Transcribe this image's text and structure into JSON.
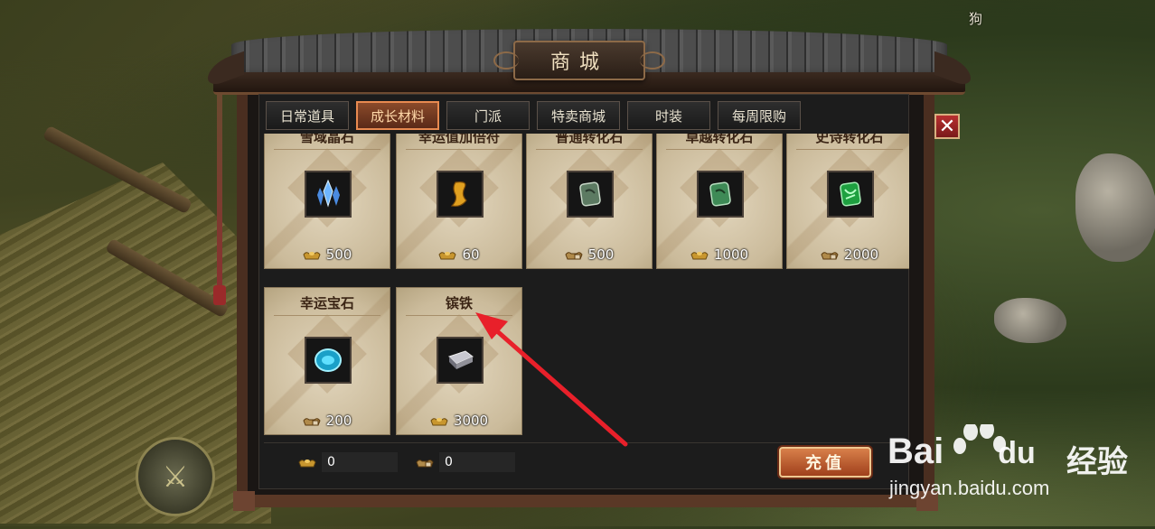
{
  "window": {
    "title": "商城"
  },
  "tabs": [
    {
      "label": "日常道具",
      "active": false
    },
    {
      "label": "成长材料",
      "active": true
    },
    {
      "label": "门派",
      "active": false
    },
    {
      "label": "特卖商城",
      "active": false
    },
    {
      "label": "时装",
      "active": false
    },
    {
      "label": "每周限购",
      "active": false
    }
  ],
  "items": [
    {
      "name": "雪域晶石",
      "price": "500",
      "currency": "gold-ingot",
      "icon": "crystal-icon"
    },
    {
      "name": "幸运值加倍符",
      "price": "60",
      "currency": "gold-ingot",
      "icon": "talisman-icon"
    },
    {
      "name": "普通转化石",
      "price": "500",
      "currency": "bound-ingot",
      "icon": "jade-stone-icon"
    },
    {
      "name": "卓越转化石",
      "price": "1000",
      "currency": "gold-ingot",
      "icon": "jade-stone-icon"
    },
    {
      "name": "史诗转化石",
      "price": "2000",
      "currency": "bound-ingot",
      "icon": "jade-stone-icon"
    },
    {
      "name": "幸运宝石",
      "price": "200",
      "currency": "bound-ingot",
      "icon": "gem-icon"
    },
    {
      "name": "镔铁",
      "price": "3000",
      "currency": "gold-ingot",
      "icon": "iron-ingot-icon"
    }
  ],
  "footer": {
    "gold_balance": "0",
    "bound_balance": "0",
    "recharge_label": "充值"
  },
  "scene": {
    "npc_name": "狗"
  },
  "watermark": {
    "brand": "Bai",
    "brand2": "du",
    "cn": "经验",
    "url": "jingyan.baidu.com"
  },
  "colors": {
    "accent": "#e88a50",
    "close": "#b83030",
    "arrow": "#e8202a"
  }
}
